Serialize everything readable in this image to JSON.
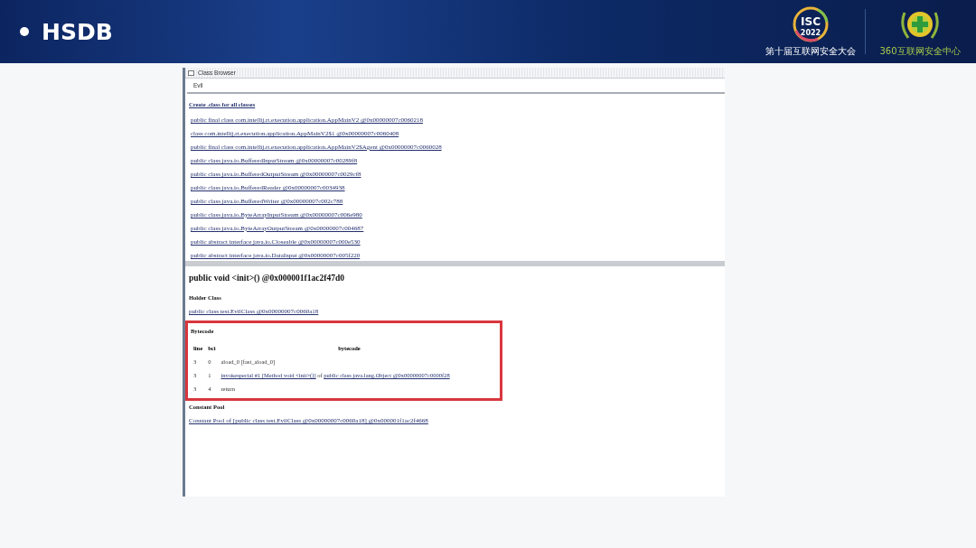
{
  "slide": {
    "title": "HSDB",
    "logos": [
      {
        "kind": "isc",
        "mark": "ISC",
        "year": "2022",
        "caption": "第十届互联网安全大会"
      },
      {
        "kind": "cross",
        "caption": "360互联网安全中心"
      }
    ]
  },
  "class_browser": {
    "title": "Class Browser",
    "search": {
      "value": "Evil"
    },
    "create_link": "Create .class for all classes",
    "classes": [
      "public final class com.intellij.rt.execution.application.AppMainV2 @0x00000007c0060218",
      "class com.intellij.rt.execution.application.AppMainV2$1 @0x00000007c0060408",
      "public final class com.intellij.rt.execution.application.AppMainV2$Agent @0x00000007c0060028",
      "public class java.io.BufferedInputStream @0x00000007c00289f8",
      "public class java.io.BufferedOutputStream @0x00000007c0029cf8",
      "public class java.io.BufferedReader @0x00000007c0034938",
      "public class java.io.BufferedWriter @0x00000007c002c788",
      "public class java.io.ByteArrayInputStream @0x00000007c006e980",
      "public class java.io.ByteArrayOutputStream @0x00000007c004687",
      "public abstract interface java.io.Closeable @0x00000007c000e530",
      "public abstract interface java.io.DataInput @0x00000007c005f220"
    ]
  },
  "method": {
    "title": "public void <init>() @0x000001f1ac2f47d0",
    "holder_heading": "Holder Class",
    "holder_link": "public class test.EvilClass @0x00000007c0060a18",
    "bytecode": {
      "heading": "Bytecode",
      "highlighted": true,
      "columns": [
        "line",
        "bci",
        "bytecode"
      ],
      "rows": [
        {
          "line": "3",
          "bci": "0",
          "parts": [
            {
              "text": "aload_0 [fast_aload_0]",
              "link": false
            }
          ]
        },
        {
          "line": "3",
          "bci": "1",
          "parts": [
            {
              "text": "invokespecial #1 [Method void <init>()]",
              "link": true
            },
            {
              "text": "of",
              "link": false
            },
            {
              "text": "public class java.lang.Object @0x00000007c0000f28",
              "link": true
            }
          ]
        },
        {
          "line": "3",
          "bci": "4",
          "parts": [
            {
              "text": "return",
              "link": false
            }
          ]
        }
      ]
    },
    "constant_pool_heading": "Constant Pool",
    "constant_pool_link": "Constant Pool of [public class test.EvilClass @0x00000007c0060a18] @0x000001f1ac2f4668"
  }
}
